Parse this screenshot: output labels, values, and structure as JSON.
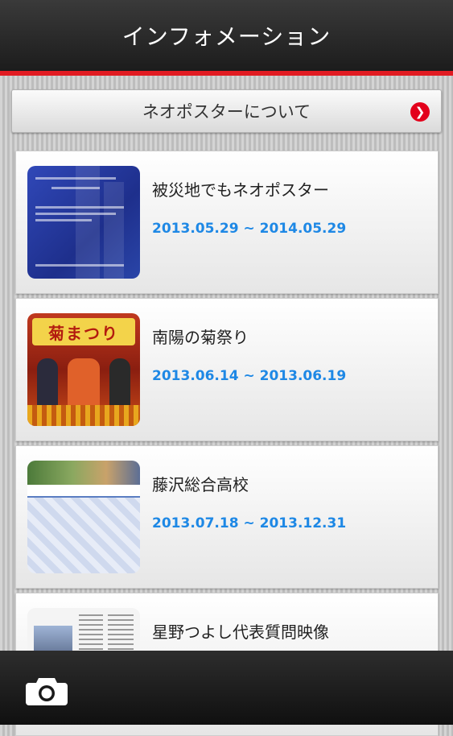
{
  "header": {
    "title": "インフォメーション"
  },
  "about_button": {
    "label": "ネオポスターについて",
    "icon": "chevron-right-icon"
  },
  "items": [
    {
      "title": "被災地でもネオポスター",
      "date": "2013.05.29 ~ 2014.05.29"
    },
    {
      "title": "南陽の菊祭り",
      "date": "2013.06.14 ~ 2013.06.19"
    },
    {
      "title": "藤沢総合高校",
      "date": "2013.07.18 ~ 2013.12.31"
    },
    {
      "title": "星野つよし代表質問映像",
      "date": ""
    }
  ],
  "thumbnail_texts": {
    "kiku": "菊まつり"
  },
  "bottom_bar": {
    "icon": "camera-icon"
  },
  "colors": {
    "accent": "#e11b22",
    "date_blue": "#1e88e5"
  }
}
